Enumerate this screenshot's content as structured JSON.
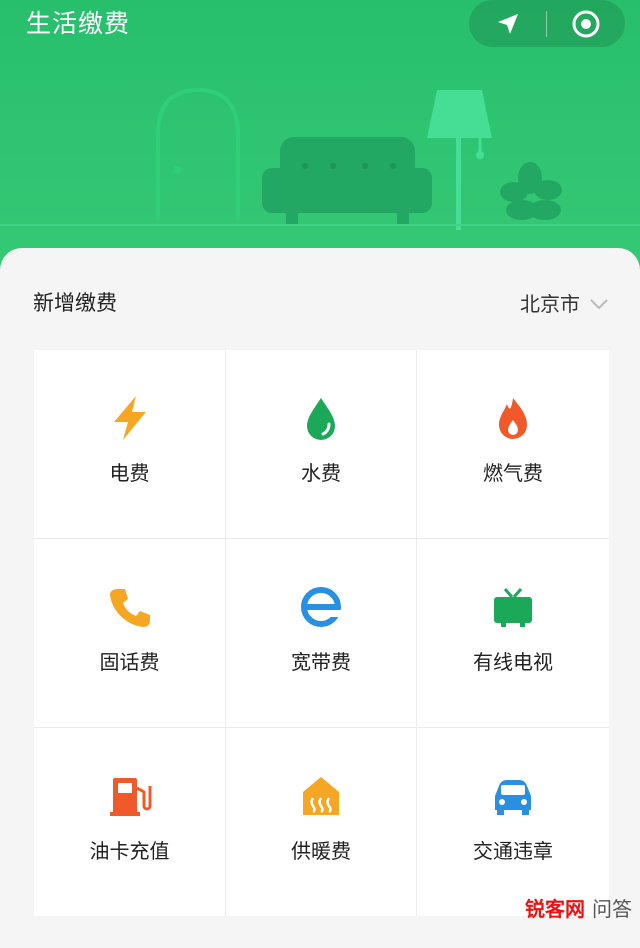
{
  "header": {
    "title": "生活缴费"
  },
  "section": {
    "title": "新增缴费",
    "city": "北京市"
  },
  "items": [
    {
      "label": "电费",
      "icon": "lightning-icon",
      "color": "#f5a623"
    },
    {
      "label": "水费",
      "icon": "water-drop-icon",
      "color": "#1ba858"
    },
    {
      "label": "燃气费",
      "icon": "flame-icon",
      "color": "#f05a2a"
    },
    {
      "label": "固话费",
      "icon": "phone-icon",
      "color": "#f5a623"
    },
    {
      "label": "宽带费",
      "icon": "broadband-e-icon",
      "color": "#2a8fe0"
    },
    {
      "label": "有线电视",
      "icon": "tv-icon",
      "color": "#1ba858"
    },
    {
      "label": "油卡充值",
      "icon": "fuel-pump-icon",
      "color": "#f05a2a"
    },
    {
      "label": "供暖费",
      "icon": "heating-house-icon",
      "color": "#f5a623"
    },
    {
      "label": "交通违章",
      "icon": "car-icon",
      "color": "#2a8fe0"
    }
  ],
  "watermark": {
    "brand": "锐客网",
    "extra": "问答"
  }
}
